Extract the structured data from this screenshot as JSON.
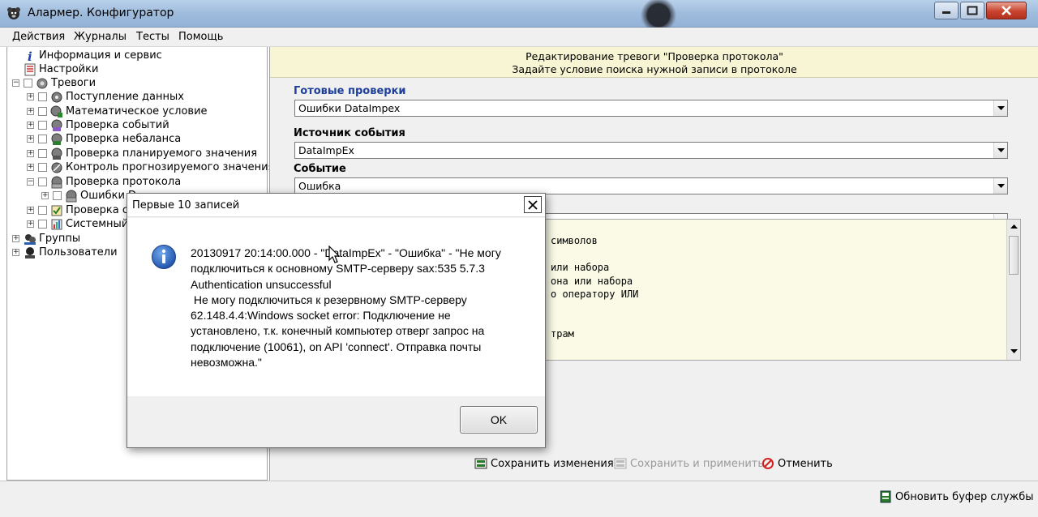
{
  "window": {
    "title": "Алармер. Конфигуратор"
  },
  "menu": [
    {
      "label": "Действия"
    },
    {
      "label": "Журналы"
    },
    {
      "label": "Тесты"
    },
    {
      "label": "Помощь"
    }
  ],
  "tree": {
    "items": [
      {
        "label": "Информация и сервис",
        "icon": "info-icon"
      },
      {
        "label": "Настройки",
        "icon": "settings-list-icon"
      },
      {
        "label": "Тревоги",
        "icon": "alarms-icon"
      },
      {
        "label": "Поступление данных",
        "icon": "gear-icon"
      },
      {
        "label": "Математическое условие",
        "icon": "math-icon"
      },
      {
        "label": "Проверка событий",
        "icon": "events-icon"
      },
      {
        "label": "Проверка небаланса",
        "icon": "balance-icon"
      },
      {
        "label": "Проверка планируемого значения",
        "icon": "plan-icon"
      },
      {
        "label": "Контроль прогнозируемого значения",
        "icon": "forecast-icon"
      },
      {
        "label": "Проверка протокола",
        "icon": "protocol-icon"
      },
      {
        "label": "Ошибки D",
        "icon": "protocol-icon"
      },
      {
        "label": "Проверка с",
        "icon": "check-icon"
      },
      {
        "label": "Системный",
        "icon": "system-icon"
      },
      {
        "label": "Группы",
        "icon": "groups-icon"
      },
      {
        "label": "Пользователи",
        "icon": "users-icon"
      }
    ]
  },
  "editor": {
    "header_line1": "Редактирование тревоги \"Проверка протокола\"",
    "header_line2": "Задайте условие поиска нужной записи в протоколе",
    "ready_checks_label": "Готовые проверки",
    "ready_checks_value": "Ошибки DataImpex",
    "source_label": "Источник события",
    "source_value": "DataImpEx",
    "event_label": "Событие",
    "event_value": "Ошибка",
    "fourth_value": "",
    "code_lines": [
      "символов",
      "или набора",
      "она или набора",
      "о оператору ИЛИ",
      "трам"
    ],
    "save_label": "Сохранить изменения",
    "save_apply_label": "Сохранить и применить",
    "cancel_label": "Отменить"
  },
  "statusbar": {
    "refresh_label": "Обновить буфер службы"
  },
  "dialog": {
    "title": "Первые 10 записей",
    "message": "20130917 20:14:00.000 - \"DataImpEx\" - \"Ошибка\" - \"Не могу\nподключиться к основному SMTP-серверу sax:535 5.7.3\nAuthentication unsuccessful\n Не могу подключиться к резервному SMTP-серверу\n62.148.4.4:Windows socket error: Подключение не\nустановлено, т.к. конечный компьютер отверг запрос на\nподключение (10061), on API 'connect'. Отправка почты\nневозможна.\"",
    "ok_label": "OK"
  }
}
